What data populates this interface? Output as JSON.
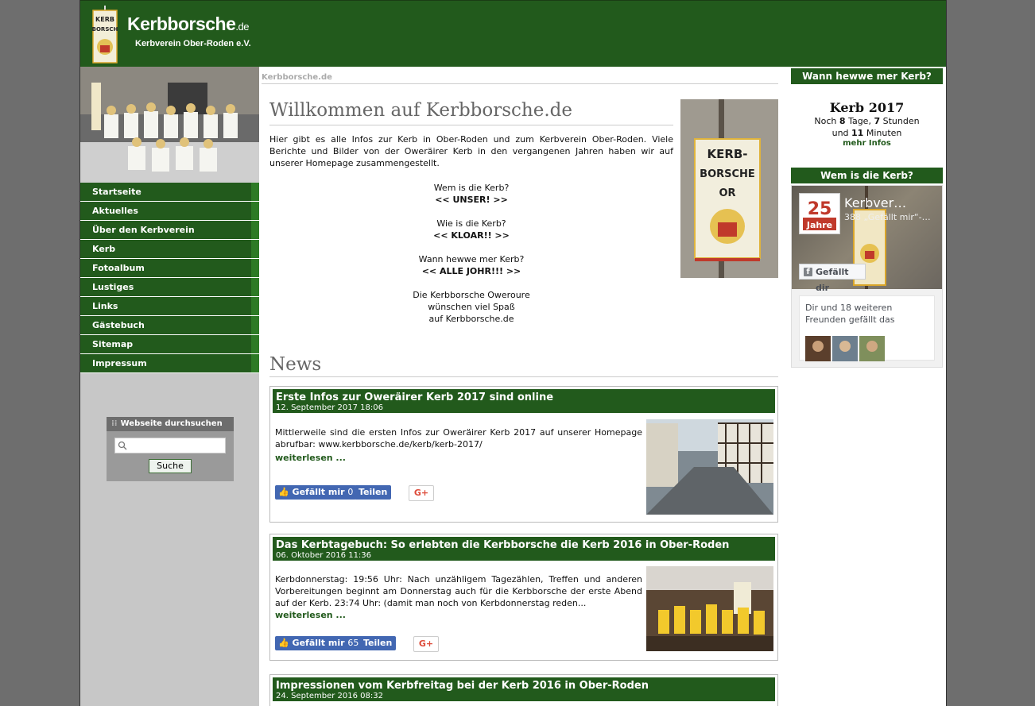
{
  "header": {
    "site_name": "Kerbborsche",
    "site_tld": ".de",
    "subtitle": "Kerbverein Ober-Roden e.V."
  },
  "nav": {
    "items": [
      {
        "label": "Startseite"
      },
      {
        "label": "Aktuelles"
      },
      {
        "label": "Über den Kerbverein"
      },
      {
        "label": "Kerb"
      },
      {
        "label": "Fotoalbum"
      },
      {
        "label": "Lustiges"
      },
      {
        "label": "Links"
      },
      {
        "label": "Gästebuch"
      },
      {
        "label": "Sitemap"
      },
      {
        "label": "Impressum"
      }
    ]
  },
  "search": {
    "heading": "Webseite durchsuchen",
    "placeholder": "",
    "button": "Suche"
  },
  "main": {
    "breadcrumb": "Kerbborsche.de",
    "welcome_title": "Willkommen auf Kerbborsche.de",
    "intro": "Hier gibt es alle Infos zur Kerb in Ober-Roden und zum Kerbverein Ober-Roden. Viele Berichte und Bilder von der Oweräirer Kerb in den vergangenen Jahren haben wir auf unserer Homepage zusammengestellt.",
    "q1": "Wem is die Kerb?",
    "a1": "<< UNSER! >>",
    "q2": "Wie is die Kerb?",
    "a2": "<< KLOAR!! >>",
    "q3": "Wann hewwe mer Kerb?",
    "a3": "<< ALLE JOHR!!! >>",
    "closing1": "Die Kerbborsche Oweroure",
    "closing2": "wünschen viel Spaß",
    "closing3": "auf Kerbborsche.de",
    "news_title": "News"
  },
  "news": [
    {
      "title": "Erste Infos zur Oweräirer Kerb 2017 sind online",
      "date": "12. September 2017 18:06",
      "text": "Mittlerweile sind die ersten Infos zur Oweräirer Kerb 2017 auf unserer Homepage abrufbar: www.kerbborsche.de/kerb/kerb-2017/",
      "readmore": "weiterlesen ...",
      "like_label": "Gefällt mir",
      "like_count": "0",
      "share": "Teilen",
      "gplus": "G+"
    },
    {
      "title": "Das Kerbtagebuch: So erlebten die Kerbborsche die Kerb 2016 in Ober-Roden",
      "date": "06. Oktober 2016 11:36",
      "text": "Kerbdonnerstag: 19:56 Uhr: Nach unzähligem Tagezählen, Treffen und anderen Vorbereitungen beginnt am Donnerstag auch für die Kerbborsche der erste Abend auf der Kerb. 23:74 Uhr: (damit man noch von Kerbdonnerstag reden...",
      "readmore": "weiterlesen ...",
      "like_label": "Gefällt mir",
      "like_count": "65",
      "share": "Teilen",
      "gplus": "G+"
    },
    {
      "title": "Impressionen vom Kerbfreitag bei der Kerb 2016 in Ober-Roden",
      "date": "24. September 2016 08:32"
    }
  ],
  "right": {
    "countdown_head": "Wann hewwe mer Kerb?",
    "kerb_title": "Kerb 2017",
    "noch": "Noch",
    "days": "8",
    "days_label": "Tage,",
    "hours": "7",
    "hours_label": "Stunden",
    "und": "und",
    "minutes": "11",
    "minutes_label": "Minuten",
    "more": "mehr Infos",
    "fb_head": "Wem is die Kerb?",
    "fb_page_name": "Kerbver…",
    "fb_likes": "388 „Gefällt mir“-…",
    "fb_badge": "25 Jahre",
    "fb_like_btn": "Gefällt dir",
    "fb_friends_text": "Dir und 18 weiteren Freunden gefällt das"
  },
  "colors": {
    "brand_green": "#225a1c",
    "facebook_blue": "#4267b2",
    "gplus_red": "#dd4b39"
  }
}
